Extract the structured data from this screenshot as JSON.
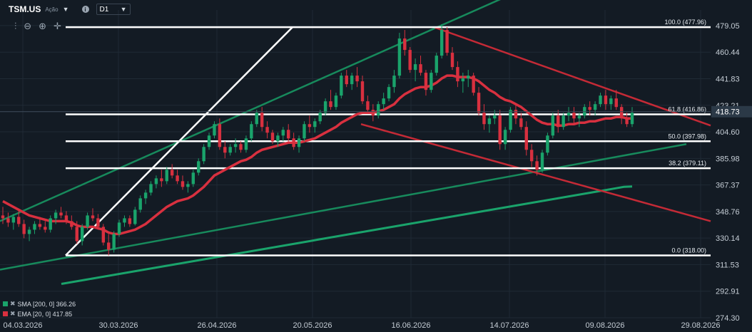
{
  "header": {
    "symbol": "TSM.US",
    "asset_type": "Ação",
    "timeframe": "D1"
  },
  "toolbar_icons": [
    "candles-icon",
    "zoom-out-icon",
    "zoom-in-icon",
    "crosshair-icon"
  ],
  "indicators": [
    {
      "label": "SMA [200, 0] 366.26",
      "color": "#1aa36b"
    },
    {
      "label": "EMA [20, 0] 417.85",
      "color": "#d8303f"
    }
  ],
  "colors": {
    "up": "#1aa36b",
    "down": "#d8303f",
    "background": "#131b24",
    "grid": "#1f2a35",
    "price_tag": "#2b3947"
  },
  "chart_data": {
    "type": "candlestick",
    "title": "",
    "xlabel": "",
    "ylabel": "",
    "ylim": [
      274.3,
      490.0
    ],
    "y_ticks": [
      "479.05",
      "460.44",
      "441.83",
      "423.21",
      "404.60",
      "385.98",
      "367.37",
      "348.76",
      "330.14",
      "311.53",
      "292.91",
      "274.30"
    ],
    "x_ticks": [
      "04.03.2026",
      "30.03.2026",
      "26.04.2026",
      "20.05.2026",
      "16.06.2026",
      "14.07.2026",
      "09.08.2026",
      "29.08.2026"
    ],
    "current_price": "418.73",
    "fibonacci": [
      {
        "label": "100.0 (477.96)",
        "value": 477.96
      },
      {
        "label": "61.8 (416.86)",
        "value": 416.86
      },
      {
        "label": "50.0 (397.98)",
        "value": 397.98
      },
      {
        "label": "38.2 (379.11)",
        "value": 379.11
      },
      {
        "label": "0.0 (318.00)",
        "value": 318.0
      }
    ],
    "candles": [
      [
        346,
        352,
        340,
        344
      ],
      [
        344,
        348,
        338,
        341
      ],
      [
        341,
        347,
        336,
        345
      ],
      [
        345,
        349,
        338,
        340
      ],
      [
        340,
        343,
        330,
        333
      ],
      [
        333,
        338,
        328,
        336
      ],
      [
        336,
        342,
        333,
        340
      ],
      [
        340,
        345,
        336,
        338
      ],
      [
        338,
        342,
        334,
        336
      ],
      [
        336,
        346,
        334,
        344
      ],
      [
        344,
        350,
        340,
        348
      ],
      [
        348,
        352,
        344,
        346
      ],
      [
        346,
        349,
        340,
        342
      ],
      [
        342,
        346,
        336,
        338
      ],
      [
        338,
        342,
        326,
        328
      ],
      [
        328,
        340,
        325,
        338
      ],
      [
        338,
        348,
        336,
        346
      ],
      [
        346,
        351,
        342,
        344
      ],
      [
        344,
        347,
        336,
        338
      ],
      [
        338,
        340,
        325,
        327
      ],
      [
        327,
        333,
        318,
        322
      ],
      [
        322,
        335,
        320,
        333
      ],
      [
        333,
        343,
        331,
        341
      ],
      [
        341,
        346,
        338,
        344
      ],
      [
        344,
        346,
        338,
        340
      ],
      [
        340,
        352,
        339,
        350
      ],
      [
        350,
        360,
        348,
        358
      ],
      [
        358,
        364,
        354,
        362
      ],
      [
        362,
        370,
        360,
        368
      ],
      [
        368,
        374,
        365,
        372
      ],
      [
        372,
        378,
        366,
        370
      ],
      [
        370,
        380,
        368,
        378
      ],
      [
        378,
        382,
        372,
        374
      ],
      [
        374,
        378,
        368,
        370
      ],
      [
        370,
        374,
        364,
        366
      ],
      [
        366,
        370,
        362,
        368
      ],
      [
        368,
        378,
        366,
        376
      ],
      [
        376,
        386,
        374,
        384
      ],
      [
        384,
        396,
        382,
        394
      ],
      [
        394,
        404,
        392,
        402
      ],
      [
        402,
        412,
        400,
        410
      ],
      [
        410,
        414,
        392,
        394
      ],
      [
        394,
        398,
        386,
        390
      ],
      [
        390,
        396,
        388,
        394
      ],
      [
        394,
        400,
        390,
        396
      ],
      [
        396,
        398,
        390,
        392
      ],
      [
        392,
        402,
        390,
        400
      ],
      [
        400,
        412,
        398,
        410
      ],
      [
        410,
        420,
        408,
        418
      ],
      [
        418,
        422,
        405,
        408
      ],
      [
        408,
        412,
        400,
        404
      ],
      [
        404,
        406,
        396,
        398
      ],
      [
        398,
        404,
        394,
        402
      ],
      [
        402,
        408,
        398,
        406
      ],
      [
        406,
        410,
        398,
        400
      ],
      [
        400,
        404,
        392,
        394
      ],
      [
        394,
        402,
        390,
        400
      ],
      [
        400,
        412,
        398,
        410
      ],
      [
        410,
        416,
        404,
        408
      ],
      [
        408,
        414,
        404,
        412
      ],
      [
        412,
        420,
        410,
        418
      ],
      [
        418,
        428,
        416,
        426
      ],
      [
        426,
        434,
        420,
        422
      ],
      [
        422,
        432,
        420,
        430
      ],
      [
        430,
        446,
        428,
        444
      ],
      [
        444,
        448,
        436,
        438
      ],
      [
        438,
        446,
        434,
        444
      ],
      [
        444,
        450,
        436,
        440
      ],
      [
        440,
        444,
        424,
        426
      ],
      [
        426,
        430,
        418,
        420
      ],
      [
        420,
        424,
        412,
        416
      ],
      [
        416,
        426,
        414,
        424
      ],
      [
        424,
        432,
        420,
        428
      ],
      [
        428,
        438,
        426,
        436
      ],
      [
        436,
        448,
        432,
        444
      ],
      [
        444,
        474,
        442,
        470
      ],
      [
        470,
        476,
        458,
        462
      ],
      [
        462,
        464,
        446,
        448
      ],
      [
        448,
        456,
        440,
        452
      ],
      [
        452,
        458,
        444,
        446
      ],
      [
        446,
        448,
        430,
        434
      ],
      [
        434,
        448,
        432,
        446
      ],
      [
        446,
        460,
        444,
        458
      ],
      [
        458,
        480,
        456,
        476
      ],
      [
        476,
        478,
        458,
        460
      ],
      [
        460,
        464,
        448,
        450
      ],
      [
        450,
        454,
        436,
        440
      ],
      [
        440,
        446,
        432,
        442
      ],
      [
        442,
        448,
        436,
        444
      ],
      [
        444,
        446,
        430,
        432
      ],
      [
        432,
        436,
        416,
        418
      ],
      [
        418,
        424,
        406,
        410
      ],
      [
        410,
        416,
        404,
        414
      ],
      [
        414,
        420,
        410,
        416
      ],
      [
        416,
        420,
        392,
        396
      ],
      [
        396,
        408,
        392,
        406
      ],
      [
        406,
        422,
        404,
        420
      ],
      [
        420,
        424,
        410,
        414
      ],
      [
        414,
        418,
        406,
        408
      ],
      [
        408,
        412,
        388,
        392
      ],
      [
        392,
        396,
        380,
        384
      ],
      [
        384,
        388,
        374,
        378
      ],
      [
        378,
        392,
        376,
        390
      ],
      [
        390,
        404,
        388,
        402
      ],
      [
        402,
        418,
        400,
        416
      ],
      [
        416,
        420,
        404,
        408
      ],
      [
        408,
        418,
        406,
        416
      ],
      [
        416,
        422,
        412,
        418
      ],
      [
        418,
        422,
        410,
        414
      ],
      [
        414,
        418,
        408,
        416
      ],
      [
        416,
        424,
        414,
        422
      ],
      [
        422,
        426,
        416,
        420
      ],
      [
        420,
        426,
        416,
        424
      ],
      [
        424,
        432,
        422,
        430
      ],
      [
        430,
        434,
        420,
        424
      ],
      [
        424,
        430,
        420,
        428
      ],
      [
        428,
        434,
        420,
        422
      ],
      [
        422,
        424,
        410,
        414
      ],
      [
        414,
        418,
        408,
        410
      ],
      [
        410,
        422,
        408,
        418
      ]
    ],
    "ema_20": [
      356,
      354,
      352,
      350,
      348,
      346,
      345,
      344,
      343,
      342,
      342,
      342,
      342,
      341,
      339,
      338,
      338,
      338,
      337,
      336,
      334,
      333,
      333,
      334,
      335,
      336,
      338,
      340,
      343,
      346,
      349,
      352,
      354,
      356,
      357,
      358,
      360,
      363,
      366,
      370,
      374,
      376,
      378,
      380,
      382,
      384,
      385,
      387,
      390,
      392,
      393,
      394,
      395,
      396,
      397,
      397,
      397,
      398,
      399,
      400,
      402,
      404,
      406,
      408,
      411,
      413,
      415,
      417,
      418,
      418,
      418,
      419,
      420,
      422,
      424,
      428,
      431,
      433,
      435,
      436,
      436,
      437,
      439,
      442,
      444,
      444,
      443,
      443,
      443,
      442,
      440,
      437,
      434,
      432,
      429,
      427,
      426,
      424,
      422,
      419,
      416,
      413,
      411,
      410,
      410,
      409,
      409,
      410,
      410,
      411,
      411,
      412,
      412,
      413,
      414,
      414,
      415,
      415,
      414,
      414
    ],
    "sma_200": [
      298,
      299,
      300,
      301,
      302,
      303,
      304,
      305,
      306,
      307,
      308,
      309,
      310,
      311,
      312,
      313,
      314,
      315,
      316,
      317,
      318,
      319,
      320,
      321,
      322,
      323,
      324,
      325,
      326,
      327,
      328,
      329,
      330,
      331,
      332,
      333,
      334,
      335,
      336,
      337,
      338,
      339,
      340,
      341,
      342,
      343,
      344,
      345,
      346,
      347,
      348,
      349,
      350,
      351,
      352,
      353,
      354,
      355,
      356,
      357,
      358,
      359,
      360,
      361,
      362,
      363,
      364,
      365,
      366,
      366.26
    ]
  }
}
